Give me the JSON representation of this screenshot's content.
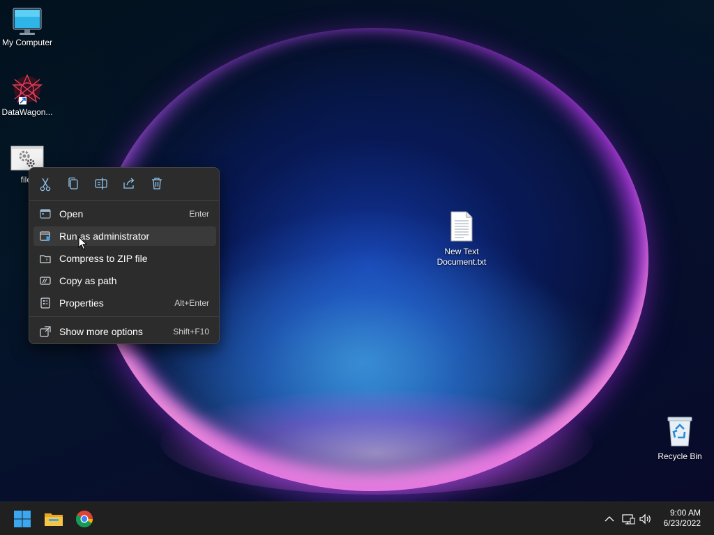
{
  "desktop": {
    "icons": [
      {
        "label": "My Computer",
        "icon": "monitor-icon"
      },
      {
        "label": "DataWagon...",
        "icon": "datawagon-app-icon"
      },
      {
        "label": "file.",
        "icon": "settings-file-icon"
      },
      {
        "label": "New Text Document.txt",
        "icon": "text-document-icon"
      },
      {
        "label": "Recycle Bin",
        "icon": "recycle-bin-icon"
      }
    ]
  },
  "context_menu": {
    "toolbar": [
      {
        "icon": "cut-icon"
      },
      {
        "icon": "copy-icon"
      },
      {
        "icon": "rename-icon"
      },
      {
        "icon": "share-icon"
      },
      {
        "icon": "delete-icon"
      }
    ],
    "items": [
      {
        "label": "Open",
        "shortcut": "Enter",
        "icon": "open-icon"
      },
      {
        "label": "Run as administrator",
        "shortcut": "",
        "icon": "admin-shield-icon"
      },
      {
        "label": "Compress to ZIP file",
        "shortcut": "",
        "icon": "zip-folder-icon"
      },
      {
        "label": "Copy as path",
        "shortcut": "",
        "icon": "copy-path-icon"
      },
      {
        "label": "Properties",
        "shortcut": "Alt+Enter",
        "icon": "properties-icon"
      },
      {
        "label": "Show more options",
        "shortcut": "Shift+F10",
        "icon": "more-options-icon"
      }
    ],
    "hovered_item": "Run as administrator"
  },
  "taskbar": {
    "pinned": [
      {
        "icon": "windows-start-icon"
      },
      {
        "icon": "file-explorer-icon"
      },
      {
        "icon": "chrome-icon"
      }
    ],
    "tray": [
      {
        "icon": "chevron-up-icon"
      },
      {
        "icon": "network-icon"
      },
      {
        "icon": "volume-icon"
      }
    ],
    "clock": {
      "time": "9:00 AM",
      "date": "6/23/2022"
    }
  },
  "colors": {
    "menu_bg": "#2c2c2c",
    "taskbar_bg": "#202020",
    "accent_blue": "#3ba7f0"
  }
}
